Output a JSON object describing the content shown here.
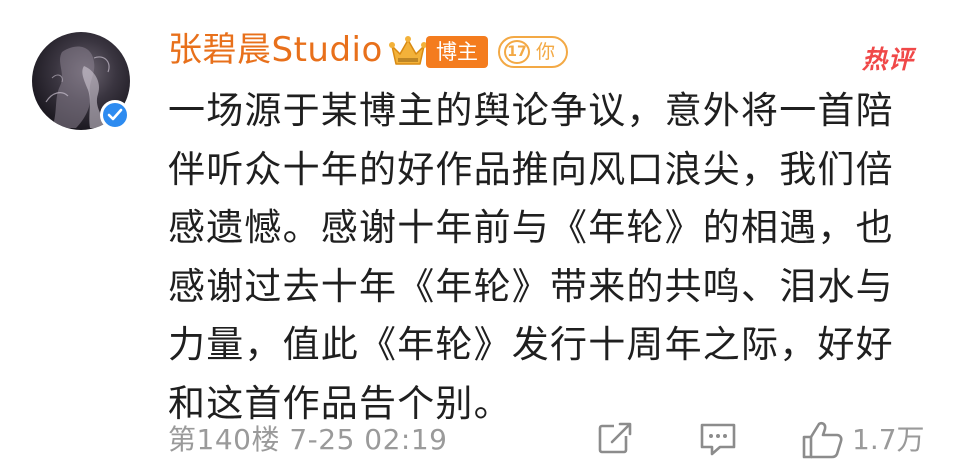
{
  "comment": {
    "username": "张碧晨Studio",
    "role_badge": "博主",
    "level": "17",
    "level_suffix": "你",
    "hot_label": "热评",
    "text": "一场源于某博主的舆论争议，意外将一首陪伴听众十年的好作品推向风口浪尖，我们倍感遗憾。感谢十年前与《年轮》的相遇，也感谢过去十年《年轮》带来的共鸣、泪水与力量，值此《年轮》发行十周年之际，好好和这首作品告个别。",
    "floor_time": "第140楼 7-25 02:19",
    "like_count": "1.7万"
  },
  "colors": {
    "username": "#e8701b",
    "hot": "#f04848",
    "meta": "#9a9a9a",
    "verified": "#2d8bf0"
  },
  "icons": {
    "avatar": "avatar-image",
    "verified": "verified-check-icon",
    "crown": "crown-icon",
    "repost": "repost-icon",
    "comment": "comment-icon",
    "like": "thumbs-up-icon"
  }
}
